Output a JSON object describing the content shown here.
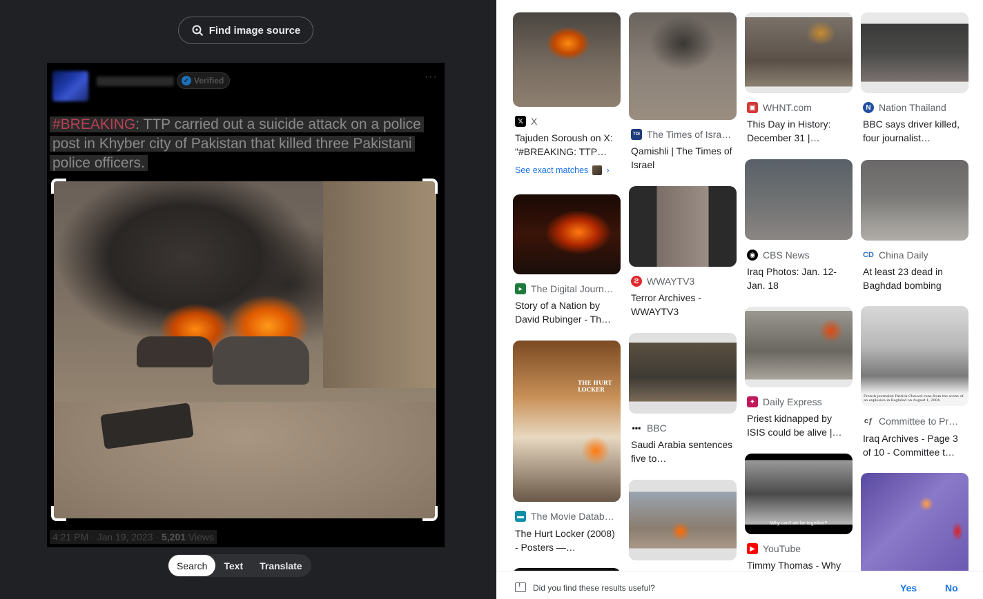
{
  "left": {
    "find_source_label": "Find image source",
    "tweet": {
      "verified_label": "Verified",
      "more_label": "···",
      "hashtag": "#BREAKING",
      "text_rest": ": TTP carried out a suicide attack on a police post in Khyber city of Pakistan that killed three Pakistani police officers.",
      "meta_time": "4:21 PM · Jan 19, 2023 · ",
      "meta_views_count": "5,201",
      "meta_views_label": " Views"
    },
    "mode_tabs": [
      "Search",
      "Text",
      "Translate"
    ]
  },
  "results": {
    "exact_matches_label": "See exact matches",
    "cards": [
      {
        "source": "X",
        "title": "Tajuden Soroush on X: \"#BREAKING: TTP…",
        "favicon": "x-icon",
        "fav_color": "#000000"
      },
      {
        "source": "The Digital Journ…",
        "title": "Story of a Nation by David Rubinger - Th…",
        "favicon": "digital-journal-icon",
        "fav_color": "#1e7a3c"
      },
      {
        "source": "The Movie Datab…",
        "title": "The Hurt Locker (2008) - Posters —…",
        "favicon": "tmdb-icon",
        "fav_color": "#0d8fa8"
      },
      {
        "source": "The Times of Isra…",
        "title": "Qamishli | The Times of Israel",
        "favicon": "times-of-israel-icon",
        "fav_color": "#1d3c7a"
      },
      {
        "source": "WWAYTV3",
        "title": "Terror Archives - WWAYTV3",
        "favicon": "wway-icon",
        "fav_color": "#e0282e"
      },
      {
        "source": "BBC",
        "title": "Saudi Arabia sentences five to…",
        "favicon": "bbc-icon",
        "fav_color": "#000000"
      },
      {
        "source": "WHNT.com",
        "title": "This Day in History: December 31 |…",
        "favicon": "whnt-icon",
        "fav_color": "#d23a3a"
      },
      {
        "source": "CBS News",
        "title": "Iraq Photos: Jan. 12-Jan. 18",
        "favicon": "cbs-icon",
        "fav_color": "#000000"
      },
      {
        "source": "Daily Express",
        "title": "Priest kidnapped by ISIS could be alive |…",
        "favicon": "express-icon",
        "fav_color": "#c2185b"
      },
      {
        "source": "YouTube",
        "title": "Timmy Thomas - Why",
        "favicon": "youtube-icon",
        "fav_color": "#ff0000"
      },
      {
        "source": "Nation Thailand",
        "title": "BBC says driver killed, four journalist…",
        "favicon": "nation-icon",
        "fav_color": "#1f4fa0"
      },
      {
        "source": "China Daily",
        "title": "At least 23 dead in Baghdad bombing",
        "favicon": "china-daily-icon",
        "fav_color": "#2f6fb8"
      },
      {
        "source": "Committee to Pr…",
        "title": "Iraq Archives - Page 3 of 10 - Committee t…",
        "favicon": "cpj-icon",
        "fav_color": "#444444"
      }
    ],
    "thumb_captions": {
      "hurt_locker": "THE HURT LOCKER",
      "youtube_caption": "Why can't we be together?",
      "cpj_caption": "French journalist Patrick Chauvel runs from the scene of an explosion in Baghdad on August 1, 2004."
    }
  },
  "footer": {
    "question": "Did you find these results useful?",
    "yes": "Yes",
    "no": "No"
  }
}
